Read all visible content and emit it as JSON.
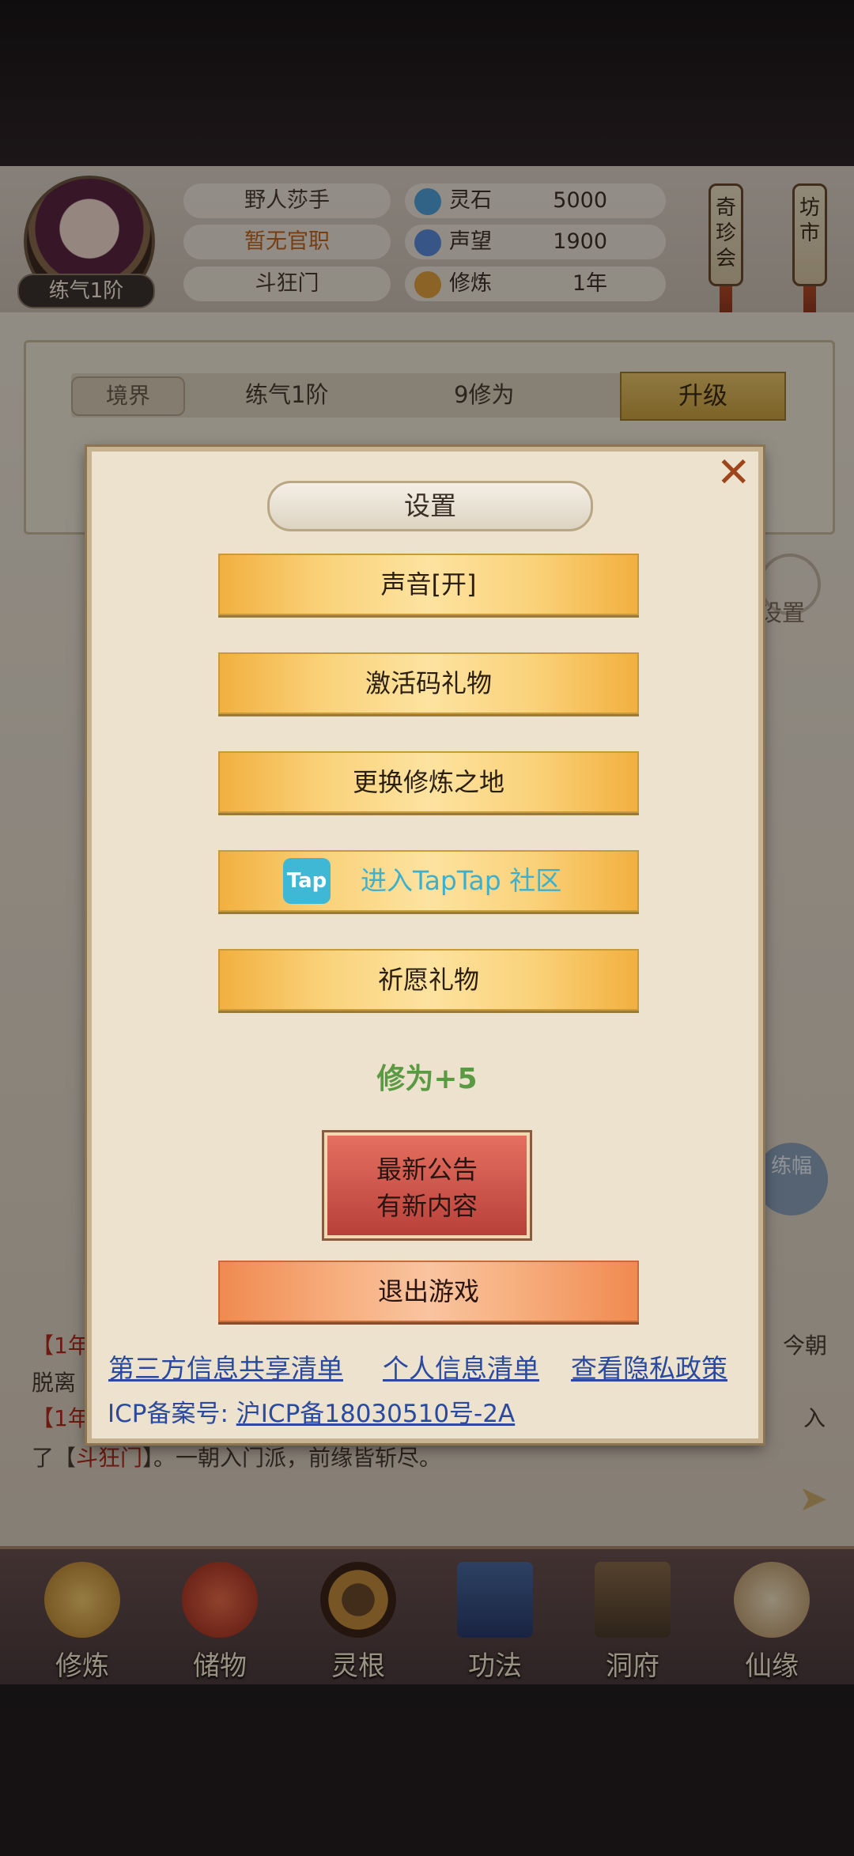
{
  "player": {
    "name": "野人莎手",
    "official_rank": "暂无官职",
    "sect": "斗狂门",
    "level_badge": "练气1阶"
  },
  "resources": [
    {
      "icon": "spirit-stone-icon",
      "label": "灵石",
      "value": "5000"
    },
    {
      "icon": "reputation-icon",
      "label": "声望",
      "value": "1900"
    },
    {
      "icon": "cultivation-icon",
      "label": "修炼",
      "value": "1年"
    }
  ],
  "side_scrolls": {
    "qizhen": "奇珍会",
    "fangshi": "坊市"
  },
  "realm": {
    "tag": "境界",
    "stage": "练气1阶",
    "progress": "9修为",
    "upgrade_label": "升级"
  },
  "side_buttons": {
    "settings_label": "设置",
    "lian_label": "练幅"
  },
  "log": {
    "line1_a": "【1年",
    "line1_b": "今朝",
    "line2": "脱离",
    "line3_a": "【1年",
    "line3_b": "入",
    "line4_pre": "了【",
    "line4_sect": "斗狂门",
    "line4_post": "】。一朝入门派，前缘皆斩尽。"
  },
  "bottom_nav": [
    {
      "label": "修炼",
      "icon": "cultivate-icon"
    },
    {
      "label": "储物",
      "icon": "storage-bag-icon"
    },
    {
      "label": "灵根",
      "icon": "spirit-root-icon"
    },
    {
      "label": "功法",
      "icon": "technique-book-icon"
    },
    {
      "label": "洞府",
      "icon": "cave-abode-icon"
    },
    {
      "label": "仙缘",
      "icon": "immortal-fate-icon"
    }
  ],
  "dialog": {
    "title": "设置",
    "buttons": {
      "sound": "声音[开]",
      "activation_code": "激活码礼物",
      "change_location": "更换修炼之地",
      "taptap_logo": "Tap",
      "taptap": "进入TapTap 社区",
      "wish_gift": "祈愿礼物"
    },
    "reward_text": "修为+5",
    "notice": {
      "line1": "最新公告",
      "line2": "有新内容"
    },
    "exit": "退出游戏",
    "links": {
      "third_party": "第三方信息共享清单",
      "personal_info": "个人信息清单",
      "privacy_policy": "查看隐私政策"
    },
    "icp_prefix": "ICP备案号: ",
    "icp_number": "沪ICP备18030510号-2A"
  },
  "colors": {
    "gold_button": "#fad27a",
    "exit_button": "#f7b080",
    "notice_button": "#d05a4a",
    "link": "#2a4aa0",
    "reward_green": "#5a9a42"
  }
}
